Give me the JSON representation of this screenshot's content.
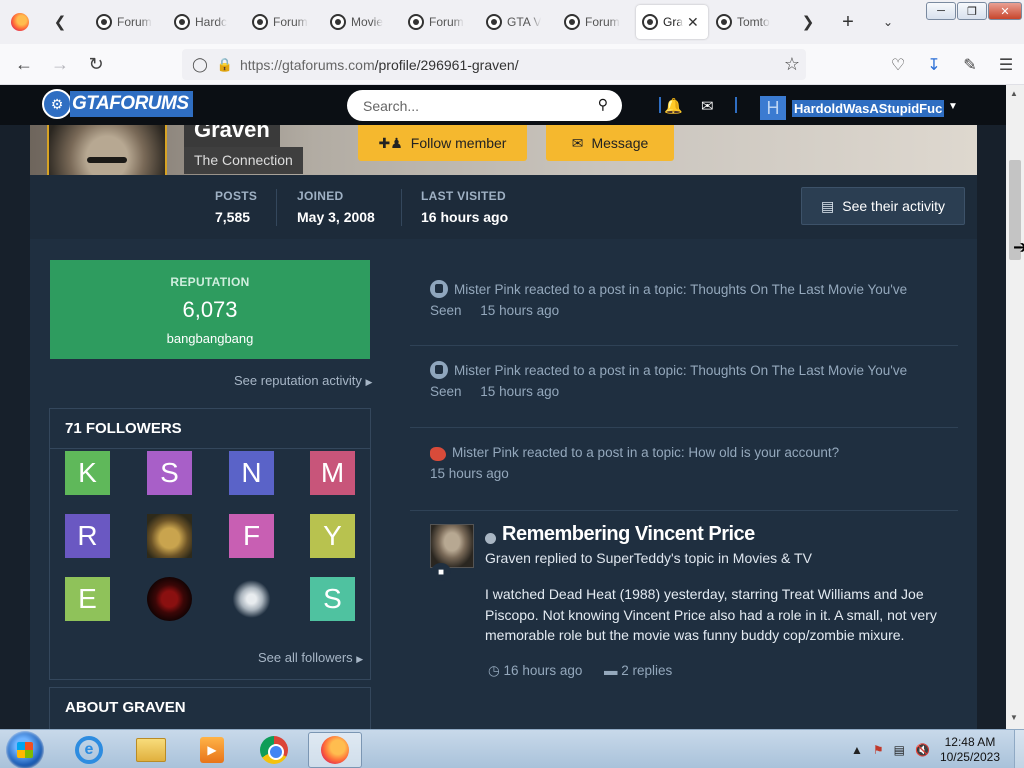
{
  "browser": {
    "tabs": [
      {
        "label": "Forum"
      },
      {
        "label": "Hardc"
      },
      {
        "label": "Forum"
      },
      {
        "label": "Movie"
      },
      {
        "label": "Forum"
      },
      {
        "label": "GTA V"
      },
      {
        "label": "Forum"
      },
      {
        "label": "Gra"
      },
      {
        "label": "Tomto"
      }
    ],
    "url_main": "https://gtaforums.com",
    "url_path": "/profile/296961-graven/"
  },
  "site": {
    "logo_text": "GTAFORUMS",
    "search_placeholder": "Search...",
    "username": "HardoldWasAStupidFuc",
    "avatar_letter": "H"
  },
  "profile": {
    "name": "Graven",
    "group": "The Connection",
    "follow_label": "Follow member",
    "message_label": "Message",
    "stats": [
      {
        "label": "POSTS",
        "value": "7,585"
      },
      {
        "label": "JOINED",
        "value": "May 3, 2008"
      },
      {
        "label": "LAST VISITED",
        "value": "16 hours ago"
      }
    ],
    "activity_label": "See their activity"
  },
  "reputation": {
    "label": "REPUTATION",
    "value": "6,073",
    "rank": "bangbangbang",
    "see_link": "See reputation activity"
  },
  "followers": {
    "title": "71 FOLLOWERS",
    "items": [
      {
        "letter": "K",
        "color": "#5fb85a"
      },
      {
        "letter": "S",
        "color": "#a85fc8"
      },
      {
        "letter": "N",
        "color": "#5a63c8"
      },
      {
        "letter": "M",
        "color": "#c8557a"
      },
      {
        "letter": "R",
        "color": "#6a58c2"
      },
      {
        "letter": "",
        "color": "photo"
      },
      {
        "letter": "F",
        "color": "#c85fb3"
      },
      {
        "letter": "Y",
        "color": "#b8c24f"
      },
      {
        "letter": "E",
        "color": "#8fc25a"
      },
      {
        "letter": "",
        "color": "red"
      },
      {
        "letter": "",
        "color": "dragon"
      },
      {
        "letter": "S",
        "color": "#4fc2a0"
      }
    ],
    "see_all": "See all followers"
  },
  "about": {
    "title": "ABOUT GRAVEN"
  },
  "feed": {
    "reactions": [
      {
        "line1": "Mister Pink reacted to a post in a topic: Thoughts On The Last Movie You've",
        "line2_prefix": "Seen",
        "time": "15 hours ago"
      },
      {
        "line1": "Mister Pink reacted to a post in a topic: Thoughts On The Last Movie You've",
        "line2_prefix": "Seen",
        "time": "15 hours ago"
      },
      {
        "line1": "Mister Pink reacted to a post in a topic: How old is your account?",
        "line2_prefix": "",
        "time": "15 hours ago"
      }
    ],
    "post": {
      "title": "Remembering Vincent Price",
      "subtitle": "Graven replied to SuperTeddy's topic in Movies & TV",
      "body": "I watched Dead Heat (1988) yesterday, starring Treat Williams and Joe Piscopo. Not knowing Vincent Price also had a role in it. A small, not very memorable role but the movie was funny buddy cop/zombie mixure.",
      "time": "16 hours ago",
      "replies": "2 replies"
    }
  },
  "taskbar": {
    "time": "12:48 AM",
    "date": "10/25/2023"
  }
}
